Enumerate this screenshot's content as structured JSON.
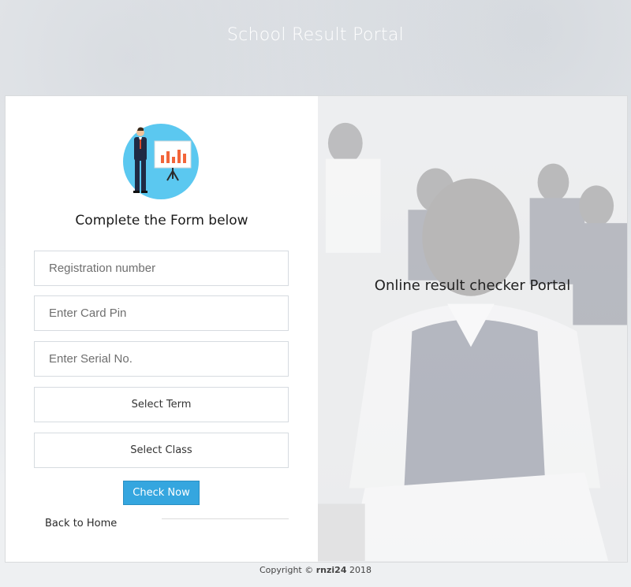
{
  "header": {
    "title": "School Result Portal"
  },
  "form": {
    "title": "Complete the Form below",
    "registration_placeholder": "Registration number",
    "card_pin_placeholder": "Enter Card Pin",
    "serial_placeholder": "Enter Serial No.",
    "term_select": "Select Term",
    "class_select": "Select Class",
    "submit_label": "Check Now",
    "back_link": "Back to Home"
  },
  "side_panel": {
    "caption": "Online result checker Portal"
  },
  "footer": {
    "prefix": "Copyright ©",
    "brand": "rnzi24",
    "year": "2018"
  },
  "colors": {
    "accent": "#35a6df",
    "illustration_bg": "#5bc8f0",
    "chart_bars": "#f2653a"
  },
  "icons": {
    "illustration": "presenter-chart-illustration"
  }
}
